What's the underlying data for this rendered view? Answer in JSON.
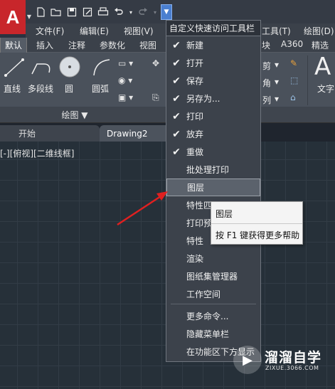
{
  "app": {
    "logo": "A",
    "logo_color": "#c8262b"
  },
  "qat": {
    "buttons": [
      "new-icon",
      "open-icon",
      "save-icon",
      "saveas-icon",
      "print-icon",
      "undo-icon",
      "redo-icon"
    ],
    "customize_icon": "chevron-down-icon"
  },
  "menubar": {
    "items": [
      "文件(F)",
      "编辑(E)",
      "视图(V)",
      "工具(T)",
      "绘图(D)"
    ]
  },
  "ribbon_tabs": [
    "默认",
    "插入",
    "注释",
    "参数化",
    "视图",
    "块",
    "A360",
    "精选"
  ],
  "ribbon": {
    "tools": [
      "直线",
      "多段线",
      "圆",
      "圆弧"
    ],
    "panel_title": "绘图 ▼",
    "right_labels": [
      "剪",
      "角",
      "列",
      "文字"
    ]
  },
  "file_tabs": [
    "开始",
    "Drawing2"
  ],
  "viewport_label": "[-][俯视][二维线框]",
  "dropdown": {
    "header": "自定义快速访问工具栏",
    "items": [
      {
        "label": "新建",
        "checked": true
      },
      {
        "label": "打开",
        "checked": true
      },
      {
        "label": "保存",
        "checked": true
      },
      {
        "label": "另存为...",
        "checked": true
      },
      {
        "label": "打印",
        "checked": true
      },
      {
        "label": "放弃",
        "checked": true
      },
      {
        "label": "重做",
        "checked": true
      },
      {
        "label": "批处理打印",
        "checked": false
      },
      {
        "label": "图层",
        "checked": false
      },
      {
        "label": "特性匹配",
        "checked": false
      },
      {
        "label": "打印预览",
        "checked": false
      },
      {
        "label": "特性",
        "checked": false
      },
      {
        "label": "渲染",
        "checked": false
      },
      {
        "label": "图纸集管理器",
        "checked": false
      },
      {
        "label": "工作空间",
        "checked": false
      },
      {
        "label": "更多命令...",
        "checked": false
      },
      {
        "label": "隐藏菜单栏",
        "checked": false
      },
      {
        "label": "在功能区下方显示",
        "checked": false
      }
    ],
    "highlighted_item": "图层"
  },
  "tooltip": {
    "title": "图层",
    "help": "按 F1 键获得更多帮助"
  },
  "watermark": {
    "title": "溜溜自学",
    "url": "ZIXUE.3066.COM"
  },
  "colors": {
    "accent": "#4a7fd0",
    "arrow": "#e02020",
    "canvas_bg": "#263039"
  }
}
